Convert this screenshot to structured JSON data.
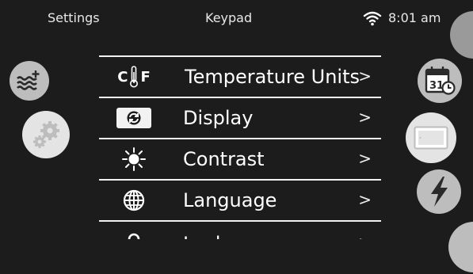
{
  "status_bar": {
    "left_label": "Settings",
    "title": "Keypad",
    "time": "8:01 am",
    "wifi_icon": "wifi-icon"
  },
  "menu": {
    "items": [
      {
        "label": "Temperature Units",
        "arrow": ">",
        "icon": "thermometer-cf-icon",
        "icon_text_c": "C",
        "icon_text_f": "F"
      },
      {
        "label": "Display",
        "arrow": ">",
        "icon": "rotate-display-icon"
      },
      {
        "label": "Contrast",
        "arrow": ">",
        "icon": "sun-icon"
      },
      {
        "label": "Language",
        "arrow": ">",
        "icon": "globe-icon"
      },
      {
        "label": "Lock spa",
        "arrow": ">",
        "icon": "lock-icon"
      }
    ]
  },
  "side_buttons": {
    "left": [
      "water-add-icon",
      "gears-icon"
    ],
    "right": [
      "calendar-clock-icon",
      "display-panel-icon",
      "lightning-icon"
    ],
    "calendar_day": "31"
  },
  "colors": {
    "background": "#1c1c1c",
    "button": "#bdbdbd",
    "divider": "#f2f2f2",
    "text": "#ffffff"
  }
}
